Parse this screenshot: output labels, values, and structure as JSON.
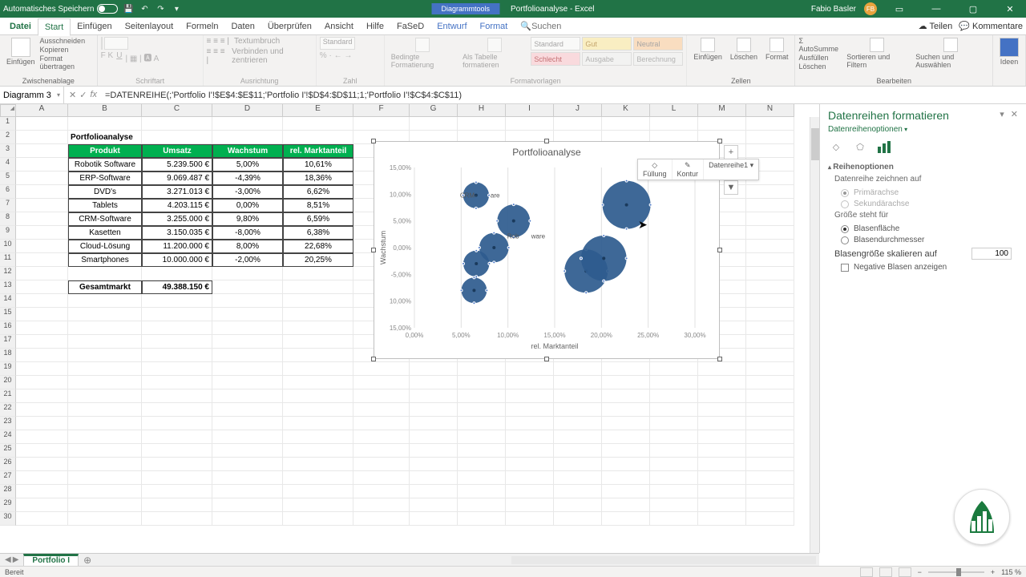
{
  "titlebar": {
    "autosave": "Automatisches Speichern",
    "chart_tools": "Diagrammtools",
    "workbook": "Portfolioanalyse - Excel",
    "user": "Fabio Basler",
    "user_initials": "FB"
  },
  "tabs": {
    "datei": "Datei",
    "start": "Start",
    "einfuegen": "Einfügen",
    "seitenlayout": "Seitenlayout",
    "formeln": "Formeln",
    "daten": "Daten",
    "ueberpruefen": "Überprüfen",
    "ansicht": "Ansicht",
    "hilfe": "Hilfe",
    "fased": "FaSeD",
    "entwurf": "Entwurf",
    "format": "Format",
    "tellme_placeholder": "Suchen",
    "teilen": "Teilen",
    "kommentare": "Kommentare"
  },
  "ribbon": {
    "clipboard": {
      "paste": "Einfügen",
      "cut": "Ausschneiden",
      "copy": "Kopieren",
      "painter": "Format übertragen",
      "group": "Zwischenablage"
    },
    "font_group": "Schriftart",
    "align": {
      "wrap": "Textumbruch",
      "merge": "Verbinden und zentrieren",
      "group": "Ausrichtung"
    },
    "number": {
      "format": "Standard",
      "group": "Zahl"
    },
    "cond": {
      "cond": "Bedingte Formatierung",
      "table": "Als Tabelle formatieren",
      "group": "Formatvorlagen"
    },
    "styles": {
      "standard": "Standard",
      "gut": "Gut",
      "neutral": "Neutral",
      "schlecht": "Schlecht",
      "ausgabe": "Ausgabe",
      "berechnung": "Berechnung"
    },
    "cells": {
      "insert": "Einfügen",
      "delete": "Löschen",
      "format": "Format",
      "group": "Zellen"
    },
    "editing": {
      "sum": "AutoSumme",
      "fill": "Ausfüllen",
      "clear": "Löschen",
      "sort": "Sortieren und Filtern",
      "find": "Suchen und Auswählen",
      "ideas": "Ideen",
      "group": "Bearbeiten"
    }
  },
  "namebox": "Diagramm 3",
  "formula": "=DATENREIHE(;'Portfolio I'!$E$4:$E$11;'Portfolio I'!$D$4:$D$11;1;'Portfolio I'!$C$4:$C$11)",
  "chart_data": {
    "type": "bubble",
    "title": "Portfolioanalyse",
    "xlabel": "rel. Marktanteil",
    "ylabel": "Wachstum",
    "xlim": [
      0,
      0.3
    ],
    "ylim": [
      -0.15,
      0.15
    ],
    "xticks": [
      "0,00%",
      "5,00%",
      "10,00%",
      "15,00%",
      "20,00%",
      "25,00%",
      "30,00%"
    ],
    "yticks": [
      "15,00%",
      "10,00%",
      "5,00%",
      "0,00%",
      "-5,00%",
      "10,00%",
      "15,00%"
    ],
    "series": [
      {
        "name": "Datenreihe1",
        "points": [
          {
            "label": "Robotik Software",
            "x": 0.1061,
            "y": 0.05,
            "size": 5239500
          },
          {
            "label": "ERP-Software",
            "x": 0.1836,
            "y": -0.0439,
            "size": 9069487
          },
          {
            "label": "DVD's",
            "x": 0.0662,
            "y": -0.03,
            "size": 3271013
          },
          {
            "label": "Tablets",
            "x": 0.0851,
            "y": 0.0,
            "size": 4203115
          },
          {
            "label": "CRM-Software",
            "x": 0.0659,
            "y": 0.098,
            "size": 3255000
          },
          {
            "label": "Kasetten",
            "x": 0.0638,
            "y": -0.08,
            "size": 3150035
          },
          {
            "label": "Cloud-Lösung",
            "x": 0.2268,
            "y": 0.08,
            "size": 11200000
          },
          {
            "label": "Smartphones",
            "x": 0.2025,
            "y": -0.02,
            "size": 10000000
          }
        ]
      }
    ]
  },
  "table": {
    "title": "Portfolioanalyse",
    "headers": [
      "Produkt",
      "Umsatz",
      "Wachstum",
      "rel. Marktanteil"
    ],
    "rows": [
      [
        "Robotik Software",
        "5.239.500 €",
        "5,00%",
        "10,61%"
      ],
      [
        "ERP-Software",
        "9.069.487 €",
        "-4,39%",
        "18,36%"
      ],
      [
        "DVD's",
        "3.271.013 €",
        "-3,00%",
        "6,62%"
      ],
      [
        "Tablets",
        "4.203.115 €",
        "0,00%",
        "8,51%"
      ],
      [
        "CRM-Software",
        "3.255.000 €",
        "9,80%",
        "6,59%"
      ],
      [
        "Kasetten",
        "3.150.035 €",
        "-8,00%",
        "6,38%"
      ],
      [
        "Cloud-Lösung",
        "11.200.000 €",
        "8,00%",
        "22,68%"
      ],
      [
        "Smartphones",
        "10.000.000 €",
        "-2,00%",
        "20,25%"
      ]
    ],
    "total_label": "Gesamtmarkt",
    "total_value": "49.388.150 €"
  },
  "mini": {
    "fill": "Füllung",
    "outline": "Kontur",
    "series": "Datenreihe1"
  },
  "pane": {
    "title": "Datenreihen formatieren",
    "subtitle": "Datenreihenoptionen",
    "section1": "Reihenoptionen",
    "draw_on": "Datenreihe zeichnen auf",
    "primary": "Primärachse",
    "secondary": "Sekundärachse",
    "size_for": "Größe steht für",
    "bubble_area": "Blasenfläche",
    "bubble_diam": "Blasendurchmesser",
    "scale": "Blasengröße skalieren auf",
    "scale_value": "100",
    "negative": "Negative Blasen anzeigen"
  },
  "sheet_tab": "Portfolio I",
  "status": {
    "ready": "Bereit",
    "zoom": "115 %"
  }
}
